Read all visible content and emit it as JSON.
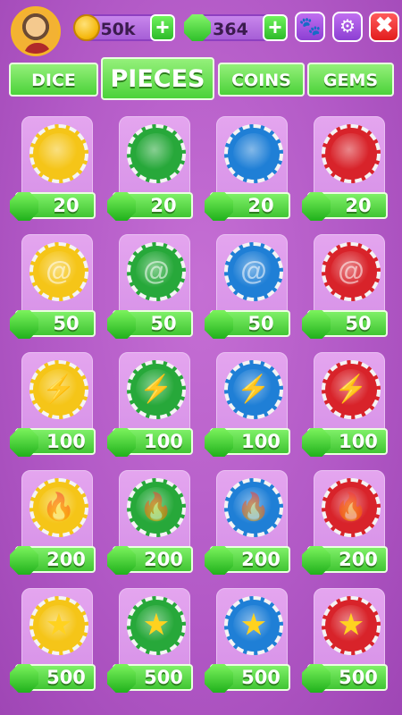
{
  "topbar": {
    "avatar_icon": "player-avatar",
    "coins": "50k",
    "gems": "364",
    "plus": "+",
    "paw_icon": "🐾",
    "gear_icon": "⚙",
    "close_icon": "✖"
  },
  "tabs": [
    {
      "label": "DICE",
      "active": false
    },
    {
      "label": "PIECES",
      "active": true
    },
    {
      "label": "COINS",
      "active": false
    },
    {
      "label": "GEMS",
      "active": false
    }
  ],
  "colors": {
    "yellow": "#f5c518",
    "green": "#27a83a",
    "blue": "#1f7fd6",
    "red": "#d8232a"
  },
  "rows": [
    {
      "style": "plain",
      "glyph": "",
      "price": "20"
    },
    {
      "style": "swirl",
      "glyph": "@",
      "price": "50"
    },
    {
      "style": "lightning",
      "glyph": "⚡",
      "price": "100"
    },
    {
      "style": "flame",
      "glyph": "🔥",
      "price": "200"
    },
    {
      "style": "star",
      "glyph": "★",
      "price": "500"
    }
  ]
}
